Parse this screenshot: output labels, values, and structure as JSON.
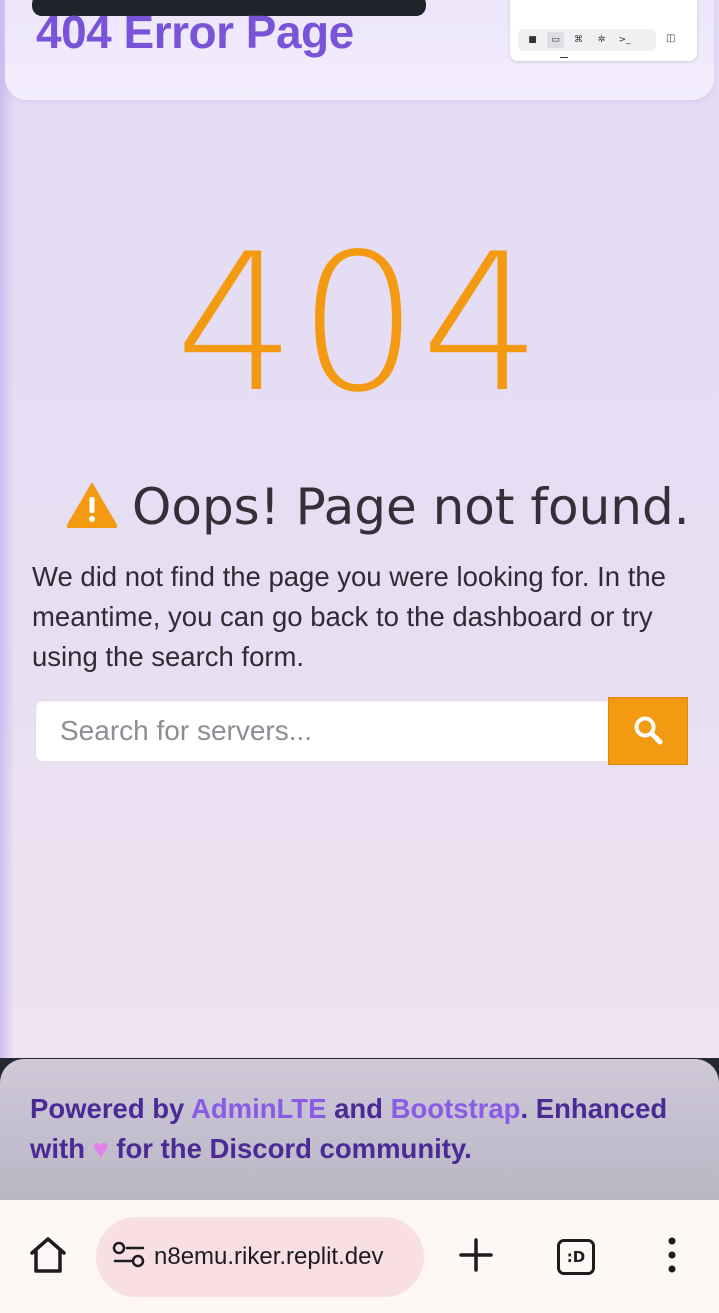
{
  "header": {
    "title": "404 Error Page"
  },
  "mini_toolbar": {
    "buttons": [
      {
        "icon": "stop-icon",
        "glyph": "■"
      },
      {
        "icon": "monitor-icon",
        "glyph": "▭"
      },
      {
        "icon": "command-icon",
        "glyph": "⌘"
      },
      {
        "icon": "brain-icon",
        "glyph": "✲"
      },
      {
        "icon": "terminal-icon",
        "glyph": ">_"
      }
    ],
    "extra_glyph": "◫"
  },
  "error": {
    "code": "404",
    "heading": "Oops! Page not found.",
    "description": "We did not find the page you were looking for. In the meantime, you can go back to the dashboard or try using the search form."
  },
  "search": {
    "placeholder": "Search for servers...",
    "value": ""
  },
  "footer": {
    "powered_by": "Powered by ",
    "link1": "AdminLTE",
    "and": " and ",
    "link2": "Bootstrap",
    "enhanced": ". Enhanced with ",
    "heart": "♥",
    "community": " for the Discord community."
  },
  "browser": {
    "url": "n8emu.riker.replit.dev",
    "tabs_label": ":D"
  },
  "colors": {
    "accent_orange": "#f39a12",
    "title_purple": "#7a54d8",
    "footer_text": "#4b2a96",
    "footer_link": "#8a5ce6",
    "heart_pink": "#e57ff0"
  }
}
